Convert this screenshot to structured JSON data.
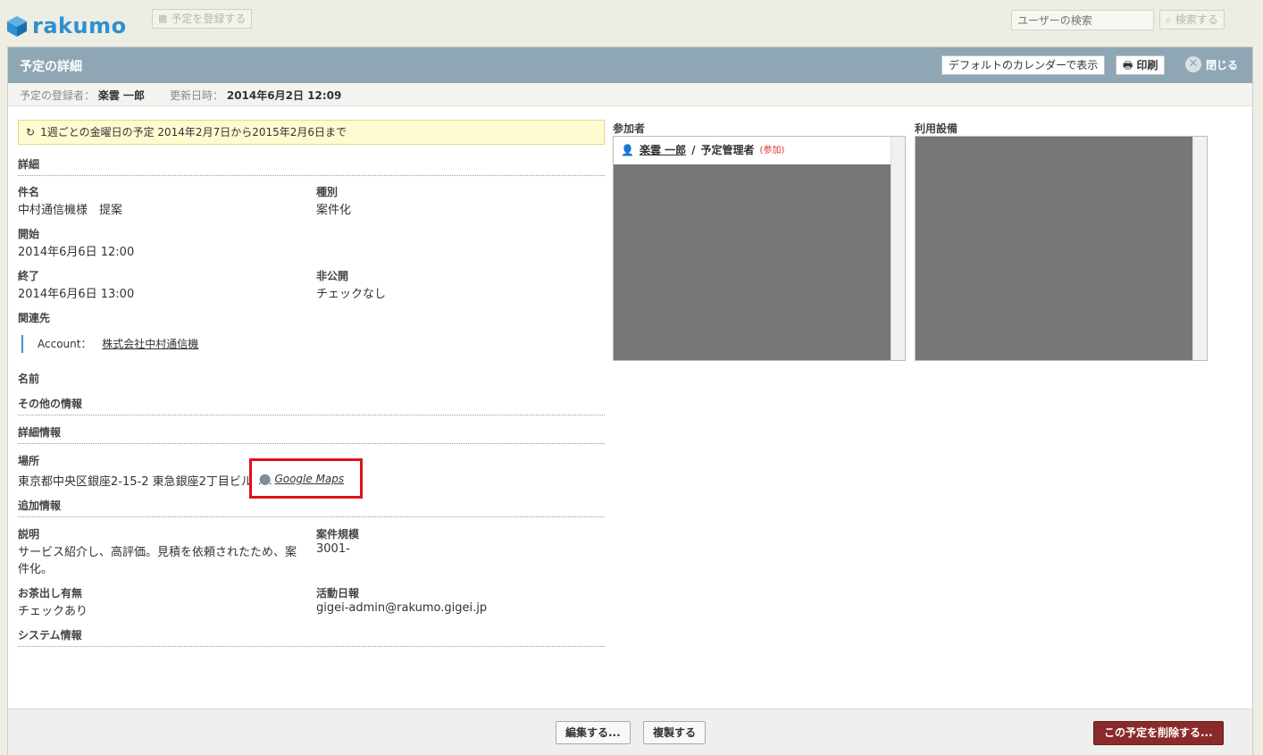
{
  "app": {
    "logo_text": "rakumo"
  },
  "topbar": {
    "register_label": "予定を登録する",
    "user_search_placeholder": "ユーザーの検索",
    "search_label": "検索する"
  },
  "panel": {
    "title": "予定の詳細",
    "default_calendar_label": "デフォルトのカレンダーで表示",
    "print_label": "印刷",
    "close_label": "閉じる"
  },
  "meta": {
    "registrant_label": "予定の登録者：",
    "registrant": "楽雲 一郎",
    "updated_label": "更新日時：",
    "updated": "2014年6月2日 12:09"
  },
  "recurrence": "1週ごとの金曜日の予定 2014年2月7日から2015年2月6日まで",
  "details": {
    "section": "詳細",
    "subject_label": "件名",
    "subject": "中村通信機様　提案",
    "type_label": "種別",
    "type": "案件化",
    "start_label": "開始",
    "start": "2014年6月6日 12:00",
    "end_label": "終了",
    "end": "2014年6月6日 13:00",
    "private_label": "非公開",
    "private": "チェックなし",
    "related_label": "関連先",
    "account_label": "Account：",
    "account": "株式会社中村通信機",
    "name_label": "名前"
  },
  "other": {
    "section": "その他の情報"
  },
  "detail_info": {
    "section": "詳細情報",
    "location_label": "場所",
    "location": "東京都中央区銀座2-15-2 東急銀座2丁目ビル",
    "maps_label": "Google Maps"
  },
  "additional": {
    "section": "追加情報",
    "desc_label": "説明",
    "desc_line1": "サービス紹介し、高評価。見積を依頼されたため、案",
    "desc_line2": "件化。",
    "scale_label": "案件規模",
    "scale": "3001-",
    "tea_label": "お茶出し有無",
    "tea": "チェックあり",
    "report_label": "活動日報",
    "report": "gigei-admin@rakumo.gigei.jp"
  },
  "system": {
    "section": "システム情報"
  },
  "participants": {
    "title": "参加者",
    "items": [
      {
        "name": "楽雲 一郎",
        "role": "予定管理者",
        "status": "(参加)"
      }
    ]
  },
  "facilities": {
    "title": "利用設備"
  },
  "footer": {
    "edit_label": "編集する...",
    "copy_label": "複製する",
    "delete_label": "この予定を削除する..."
  },
  "colors": {
    "header_bg": "#8fa7b5",
    "accent_blue": "#2f8fd0",
    "delete_red": "#8b2a2a",
    "highlight_red": "#e0101a"
  }
}
